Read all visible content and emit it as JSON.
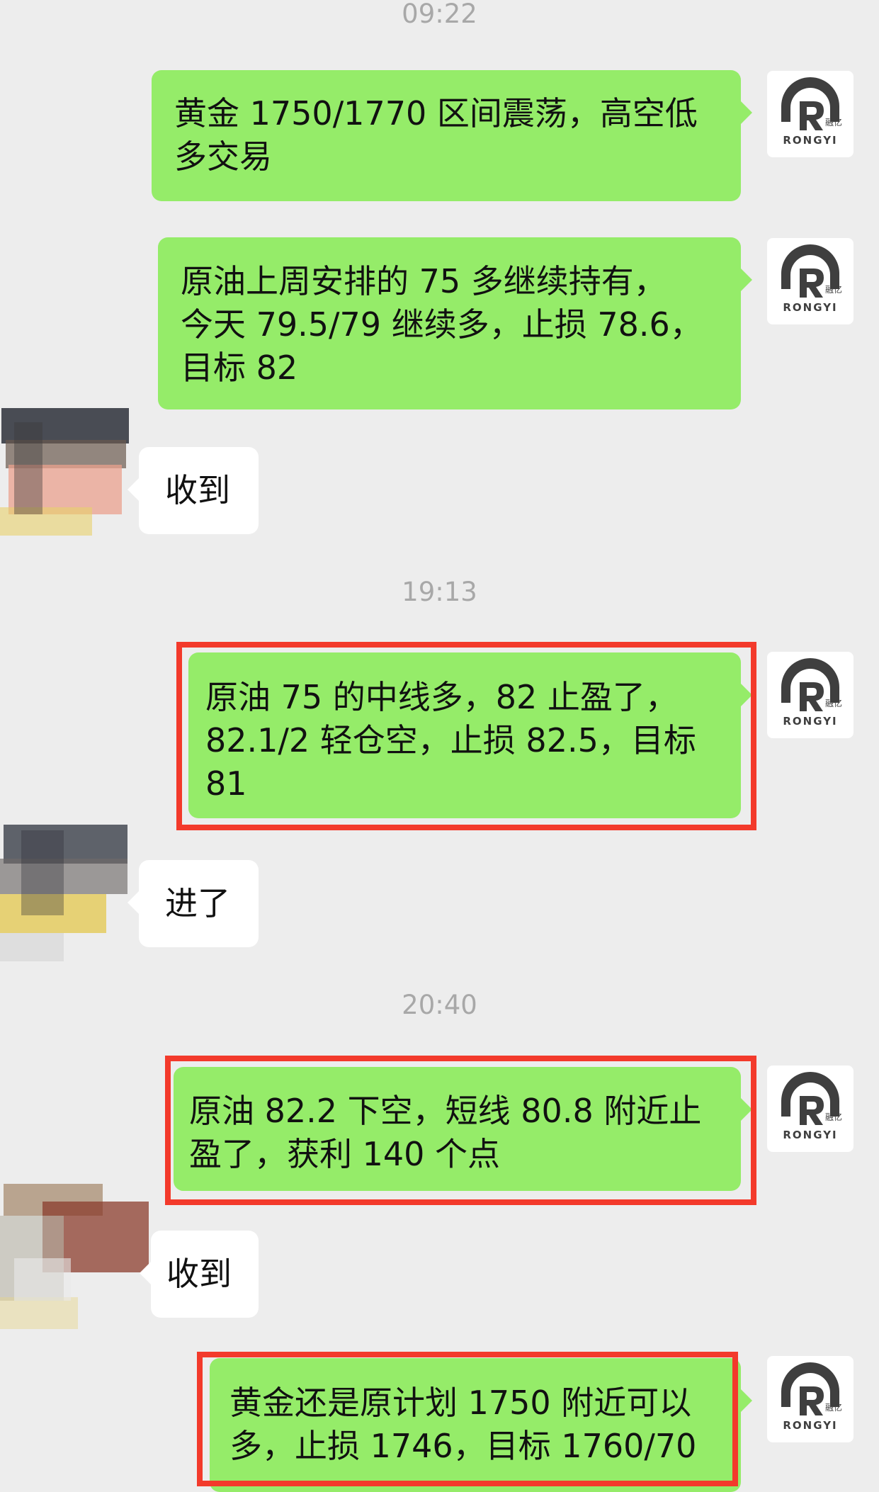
{
  "timestamps": [
    "09:22",
    "19:13",
    "20:40"
  ],
  "brand_avatar": {
    "icon": "rongyi-logo-icon",
    "chinese": "融亿",
    "latin": "RONGYI",
    "color": "#3f3f3f"
  },
  "colors": {
    "outgoing_bubble": "#95ec69",
    "incoming_bubble": "#ffffff",
    "highlight_box": "#f33a2b",
    "background": "#ededed"
  },
  "messages": [
    {
      "id": "m1",
      "side": "outgoing",
      "lines": [
        "黄金 1750/1770 区间震荡，高空低",
        "多交易"
      ]
    },
    {
      "id": "m2",
      "side": "outgoing",
      "lines": [
        "原油上周安排的 75 多继续持有，",
        "今天 79.5/79 继续多，止损 78.6，",
        "目标 82"
      ]
    },
    {
      "id": "m3",
      "side": "incoming",
      "text": "收到"
    },
    {
      "id": "m4",
      "side": "outgoing",
      "highlighted": true,
      "lines": [
        "原油 75 的中线多，82 止盈了，",
        "82.1/2 轻仓空，止损 82.5，目标",
        "81"
      ]
    },
    {
      "id": "m5",
      "side": "incoming",
      "text": "进了"
    },
    {
      "id": "m6",
      "side": "outgoing",
      "highlighted": true,
      "lines": [
        "原油 82.2 下空，短线 80.8 附近止",
        "盈了，获利 140 个点"
      ]
    },
    {
      "id": "m7",
      "side": "incoming",
      "text": "收到"
    },
    {
      "id": "m8",
      "side": "outgoing",
      "highlighted": true,
      "lines": [
        "黄金还是原计划 1750 附近可以",
        "多，止损 1746，目标 1760/70"
      ]
    }
  ]
}
